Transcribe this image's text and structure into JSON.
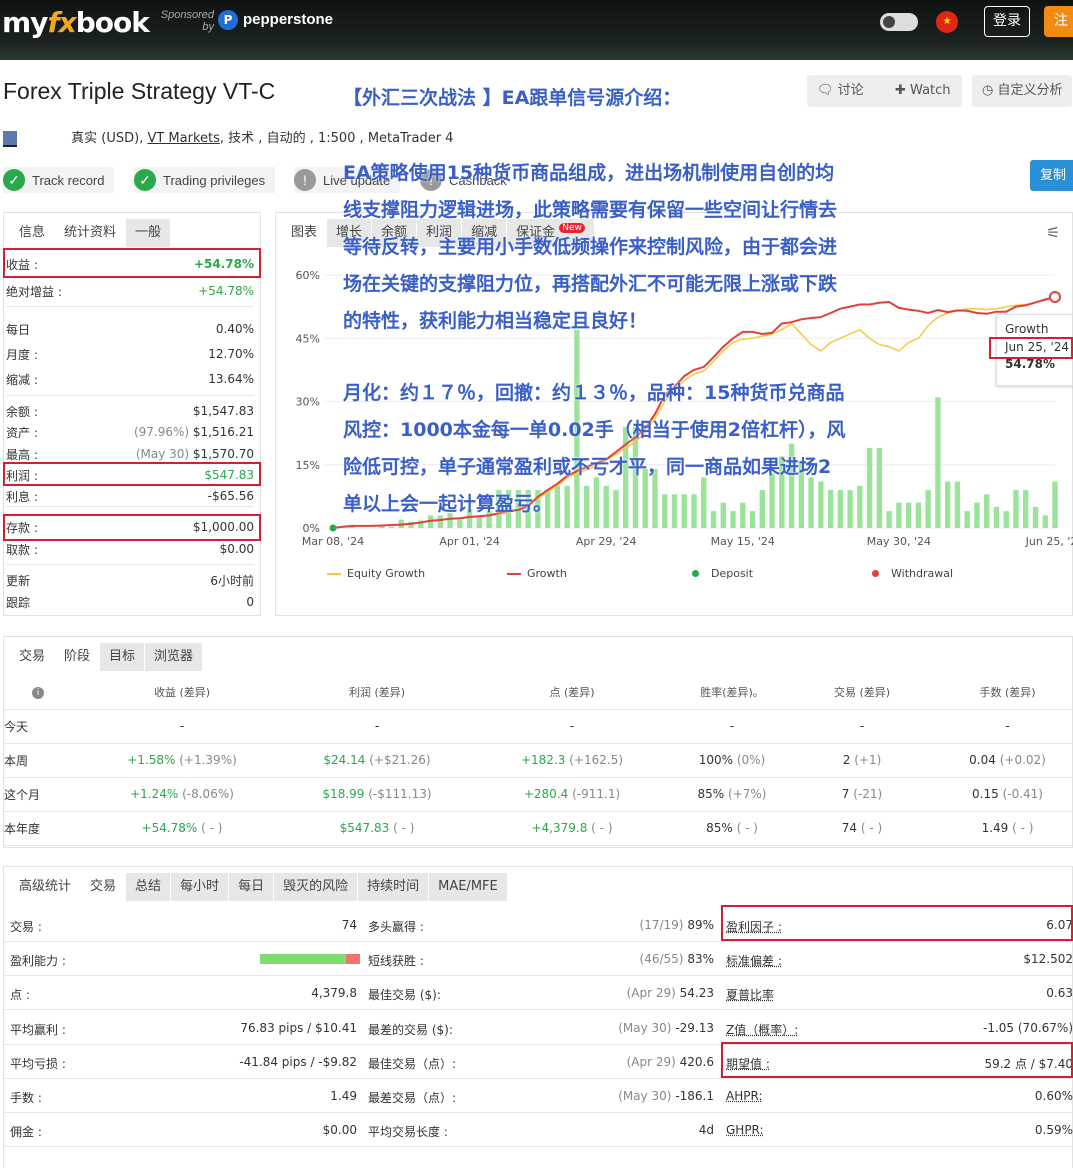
{
  "header": {
    "logo_my": "my",
    "logo_fx": "fx",
    "logo_book": "book",
    "sponsored": "Sponsored by",
    "pp_icon": "P",
    "sponsor": "pepperstone",
    "login": "登录",
    "register": "注"
  },
  "system": {
    "title": "Forex Triple Strategy VT-C",
    "discuss_btn": "讨论",
    "watch_btn": "Watch",
    "custom_btn": "自定义分析",
    "copy_btn": "复制",
    "account_type": "真实 (USD),",
    "broker": "VT Markets",
    "info_rest": ", 技术 , 自动的 , 1:500 , MetaTrader 4",
    "badges": [
      "Track record",
      "Trading privileges",
      "Live update",
      "Cashback"
    ]
  },
  "stats": {
    "tabs": [
      "信息",
      "统计资料",
      "一般"
    ],
    "rows": [
      {
        "label": "收益 :",
        "value": "+54.78%",
        "green": true
      },
      {
        "label": "绝对增益 :",
        "value": "+54.78%",
        "green": true
      },
      {
        "label": "每日",
        "value": "0.40%"
      },
      {
        "label": "月度 :",
        "value": "12.70%"
      },
      {
        "label": "缩减 :",
        "value": "13.64%"
      },
      {
        "label": "余额 :",
        "value": "$1,547.83"
      },
      {
        "label": "资产 :",
        "note": "(97.96%)",
        "value": "$1,516.21"
      },
      {
        "label": "最高 :",
        "note": "(May 30)",
        "value": "$1,570.70"
      },
      {
        "label": "利润 :",
        "value": "$547.83",
        "green": true
      },
      {
        "label": "利息 :",
        "value": "-$65.56"
      },
      {
        "label": "存款 :",
        "value": "$1,000.00"
      },
      {
        "label": "取款 :",
        "value": "$0.00"
      },
      {
        "label": "更新",
        "value": "6小时前"
      },
      {
        "label": "跟踪",
        "value": "0"
      }
    ]
  },
  "chart_panel": {
    "tabs": [
      "图表",
      "增长",
      "余额",
      "利润",
      "缩减",
      "保证金"
    ],
    "new_badge": "New",
    "tooltip": {
      "title": "Growth",
      "date": "Jun 25, '24",
      "value": "54.78%"
    },
    "legend": [
      "Equity Growth",
      "Growth",
      "Deposit",
      "Withdrawal"
    ]
  },
  "chart_data": {
    "type": "line",
    "ylim": [
      0,
      60
    ],
    "y_ticks": [
      "0%",
      "15%",
      "30%",
      "45%",
      "60%"
    ],
    "x_ticks": [
      "Mar 08, '24",
      "Apr 01, '24",
      "Apr 29, '24",
      "May 15, '24",
      "May 30, '24",
      "Jun 25, '24"
    ],
    "series": [
      {
        "name": "Growth",
        "values": [
          0,
          0.3,
          0.5,
          0.5,
          0.5,
          0.6,
          0.7,
          0.8,
          1,
          1.3,
          1.7,
          1.9,
          2.2,
          2.3,
          2.6,
          2.8,
          3,
          3.5,
          4,
          4.3,
          5.2,
          7.4,
          9,
          10.5,
          12.4,
          13.5,
          14.5,
          15.4,
          16.3,
          18,
          19.8,
          21.5,
          23.6,
          27,
          31.5,
          33.5,
          36,
          37.5,
          38.2,
          40.5,
          43,
          45,
          46.5,
          46.5,
          46,
          46.3,
          48.5,
          48.8,
          49.5,
          49.8,
          50,
          51,
          52,
          52.5,
          53,
          53,
          53.4,
          53.6,
          52.2,
          51.8,
          51.5,
          51,
          51.7,
          51.2,
          51.6,
          51.5,
          51,
          50.8,
          51.3,
          51.3,
          52.5,
          52.8,
          53.5,
          54.2,
          54.78
        ]
      },
      {
        "name": "Equity Growth",
        "values": [
          0,
          0.3,
          0.5,
          0.5,
          0.5,
          0.6,
          0.7,
          0.8,
          1,
          1.3,
          1.7,
          1.9,
          2.2,
          2.3,
          2.6,
          2.8,
          3,
          3.3,
          3.8,
          4.3,
          5.5,
          7,
          8.5,
          10,
          12,
          13,
          13.8,
          14.8,
          16,
          17.5,
          19,
          20.5,
          22.6,
          26,
          30,
          32.5,
          35,
          36.5,
          37.2,
          39.5,
          42,
          44,
          44.8,
          45,
          45.5,
          46,
          47,
          48.5,
          46,
          43.5,
          42,
          44,
          45,
          46,
          47,
          45,
          43.5,
          43,
          42,
          44,
          45,
          48,
          50,
          51,
          51.5,
          52,
          52,
          51.8,
          52,
          52.5,
          52.8,
          53,
          53.5,
          54,
          54.78
        ]
      },
      {
        "name": "Daily profit",
        "values": [
          0,
          0,
          0.3,
          0,
          0,
          0.4,
          0.3,
          2,
          1.5,
          1.8,
          3,
          3,
          3.5,
          2,
          4.5,
          3,
          4,
          9,
          9,
          9,
          9,
          9,
          9,
          10,
          10,
          47,
          10,
          12,
          10,
          9,
          24,
          24,
          14,
          14,
          8,
          8,
          8,
          8,
          12,
          4,
          6,
          4,
          6,
          4,
          9,
          13,
          17,
          20,
          16,
          12,
          11,
          9,
          9,
          9,
          10,
          19,
          19,
          4,
          6,
          6,
          6,
          9,
          31,
          11,
          11,
          4,
          6,
          8,
          5,
          4,
          9,
          9,
          5,
          3,
          11
        ]
      }
    ]
  },
  "periods": {
    "tabs": [
      "交易",
      "阶段",
      "目标",
      "浏览器"
    ],
    "info_icon": "i",
    "headers": [
      "收益 (差异)",
      "利润 (差异)",
      "点 (差异)",
      "胜率(差异)。",
      "交易 (差异)",
      "手数 (差异)"
    ],
    "rows": [
      {
        "label": "今天",
        "gain": "-",
        "gain_d": "",
        "profit": "-",
        "profit_d": "",
        "pips": "-",
        "pips_d": "",
        "win": "-",
        "win_d": "",
        "trades": "-",
        "trades_d": "",
        "lots": "-",
        "lots_d": ""
      },
      {
        "label": "本周",
        "gain": "+1.58%",
        "gain_d": "(+1.39%)",
        "profit": "$24.14",
        "profit_d": "(+$21.26)",
        "pips": "+182.3",
        "pips_d": "(+162.5)",
        "win": "100%",
        "win_d": "(0%)",
        "trades": "2",
        "trades_d": "(+1)",
        "lots": "0.04",
        "lots_d": "(+0.02)"
      },
      {
        "label": "这个月",
        "gain": "+1.24%",
        "gain_d": "(-8.06%)",
        "profit": "$18.99",
        "profit_d": "(-$111.13)",
        "pips": "+280.4",
        "pips_d": "(-911.1)",
        "win": "85%",
        "win_d": "(+7%)",
        "trades": "7",
        "trades_d": "(-21)",
        "lots": "0.15",
        "lots_d": "(-0.41)"
      },
      {
        "label": "本年度",
        "gain": "+54.78%",
        "gain_d": "( - )",
        "profit": "$547.83",
        "profit_d": "( - )",
        "pips": "+4,379.8",
        "pips_d": "( - )",
        "win": "85%",
        "win_d": "( - )",
        "trades": "74",
        "trades_d": "( - )",
        "lots": "1.49",
        "lots_d": "( - )"
      }
    ]
  },
  "advanced": {
    "tabs": [
      "高级统计",
      "交易",
      "总结",
      "每小时",
      "每日",
      "毁灭的风险",
      "持续时间",
      "MAE/MFE"
    ],
    "rows": [
      {
        "l1": "交易 :",
        "v1": "74",
        "l2": "多头赢得 :",
        "n2": "(17/19)",
        "v2": "89%",
        "l3": "盈利因子 :",
        "v3": "6.07"
      },
      {
        "l1": "盈利能力 :",
        "v1": "",
        "l2": "短线获胜 :",
        "n2": "(46/55)",
        "v2": "83%",
        "l3": "标准偏差 :",
        "v3": "$12.502"
      },
      {
        "l1": "点 :",
        "v1": "4,379.8",
        "l2": "最佳交易 ($):",
        "n2": "(Apr 29)",
        "v2": "54.23",
        "l3": "夏普比率",
        "v3": "0.63"
      },
      {
        "l1": "平均赢利 :",
        "v1": "76.83 pips / $10.41",
        "l2": "最差的交易 ($):",
        "n2": "(May 30)",
        "v2": "-29.13",
        "l3": "Z值（概率）:",
        "v3": "-1.05 (70.67%)"
      },
      {
        "l1": "平均亏损 :",
        "v1": "-41.84 pips / -$9.82",
        "l2": "最佳交易（点）:",
        "n2": "(Apr 29)",
        "v2": "420.6",
        "l3": "期望值 :",
        "v3": "59.2 点 / $7.40"
      },
      {
        "l1": "手数 :",
        "v1": "1.49",
        "l2": "最差交易（点）:",
        "n2": "(May 30)",
        "v2": "-186.1",
        "l3": "AHPR:",
        "v3": "0.60%"
      },
      {
        "l1": "佣金 :",
        "v1": "$0.00",
        "l2": "平均交易长度 :",
        "n2": "",
        "v2": "4d",
        "l3": "GHPR:",
        "v3": "0.59%"
      }
    ]
  },
  "annotation": {
    "title": "【外汇三次战法 】EA跟单信号源介绍：",
    "para1": [
      "EA策略使用15种货币商品组成，进出场机制使用自创的均",
      "线支撑阻力逻辑进场，此策略需要有保留一些空间让行情去",
      "等待反转，主要用小手数低频操作来控制风险，由于都会进",
      "场在关键的支撑阻力位，再搭配外汇不可能无限上涨或下跌",
      "的特性，获利能力相当稳定且良好！"
    ],
    "para2": [
      "月化：约１７％，回撤：约１３％，品种：15种货币兑商品",
      "风控：1000本金每一单0.02手（相当于使用2倍杠杆），风",
      "险低可控，单子通常盈利或不亏才平，同一商品如果进场2",
      "单以上会一起计算盈亏。"
    ]
  },
  "colors": {
    "green": "#2aa84a",
    "red_line": "#e2403a",
    "equity_line": "#f5c842",
    "bar": "#9be39b",
    "annotation": "#3a5fc8",
    "highlight_box": "#d32030"
  }
}
